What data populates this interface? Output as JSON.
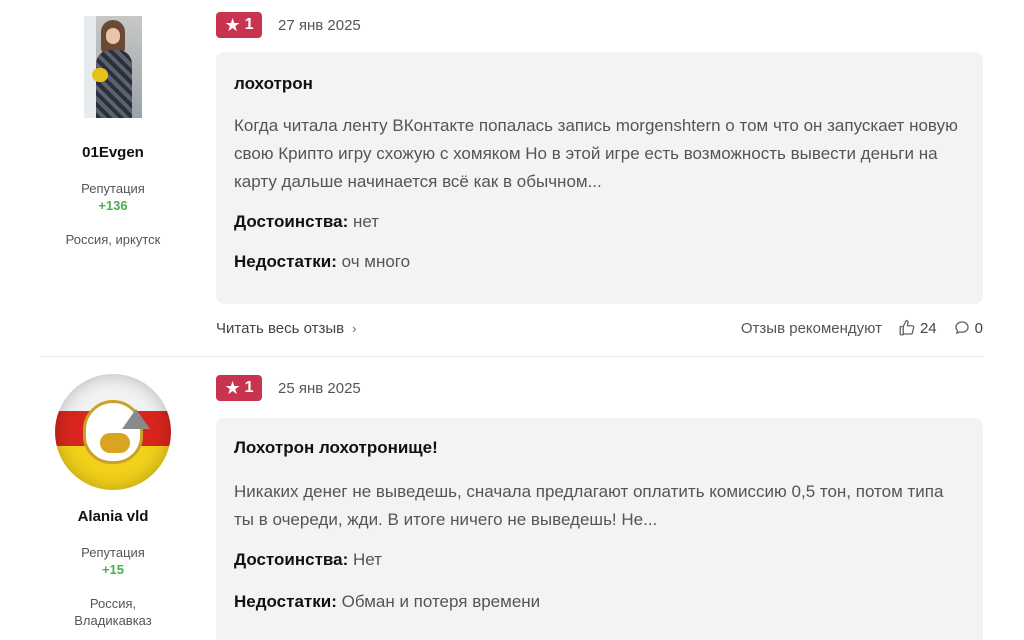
{
  "reviews": [
    {
      "author": {
        "name": "01Evgen",
        "reputation_label": "Репутация",
        "reputation_value": "+136",
        "location": "Россия, иркутск"
      },
      "rating": "1",
      "date": "27 янв 2025",
      "title": "лохотрон",
      "text": "Когда читала ленту ВКонтакте попалась запись morgenshtern о том что он запускает новую свою Крипто игру схожую с хомяком Но в этой игре есть возможность вывести деньги на карту дальше начинается всё как в обычном...",
      "pros_label": "Достоинства:",
      "pros": "нет",
      "cons_label": "Недостатки:",
      "cons": "оч много",
      "read_more": "Читать весь отзыв",
      "recommend_label": "Отзыв рекомендуют",
      "likes": "24",
      "comments": "0"
    },
    {
      "author": {
        "name": "Alania vld",
        "reputation_label": "Репутация",
        "reputation_value": "+15",
        "location_line1": "Россия,",
        "location_line2": "Владикавказ"
      },
      "rating": "1",
      "date": "25 янв 2025",
      "title": "Лохотрон лохотронище!",
      "text": "Никаких денег не выведешь, сначала предлагают оплатить комиссию 0,5 тон, потом типа ты в очереди, жди. В итоге ничего не выведешь! Не...",
      "pros_label": "Достоинства:",
      "pros": "Нет",
      "cons_label": "Недостатки:",
      "cons": "Обман и потеря времени"
    }
  ],
  "icons": {
    "rating": "star-icon",
    "read_more": "chevron-right-icon",
    "like": "thumbs-up-icon",
    "comment": "comment-bubble-icon"
  },
  "colors": {
    "rating_badge": "#c8344f",
    "reputation_positive": "#4caf50",
    "card_bg": "#f3f3f5"
  }
}
